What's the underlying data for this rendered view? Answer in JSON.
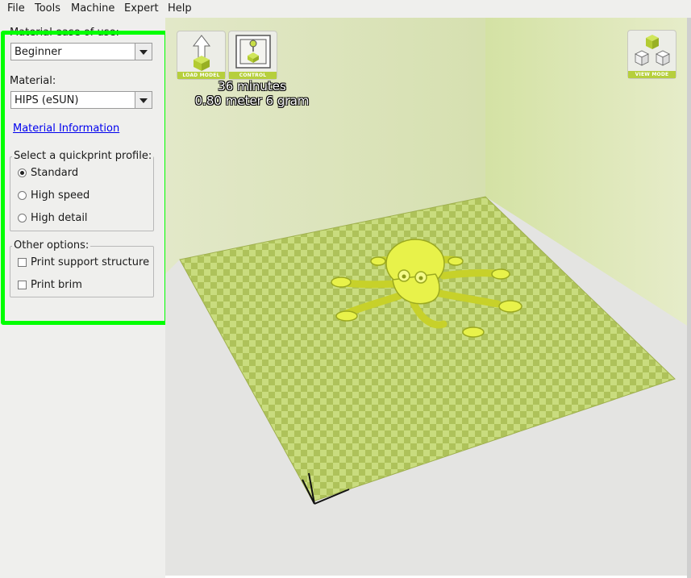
{
  "menu": [
    "File",
    "Tools",
    "Machine",
    "Expert",
    "Help"
  ],
  "left_panel": {
    "ease_label": "Material ease of use:",
    "ease_value": "Beginner",
    "material_label": "Material:",
    "material_value": "HIPS (eSUN)",
    "material_link": "Material Information",
    "quickprint_title": "Select a quickprint profile:",
    "profiles": [
      {
        "label": "Standard",
        "selected": true
      },
      {
        "label": "High speed",
        "selected": false
      },
      {
        "label": "High detail",
        "selected": false
      }
    ],
    "other_title": "Other options:",
    "options": [
      {
        "label": "Print support structure",
        "checked": false
      },
      {
        "label": "Print brim",
        "checked": false
      }
    ],
    "highlight_color": "#00ff00"
  },
  "viewport": {
    "buttons": {
      "load_model": "LOAD MODEL",
      "control": "CONTROL",
      "view_mode": "VIEW MODE"
    },
    "print_time": "36 minutes",
    "print_material": "0.80 meter 6 gram",
    "model_color": "#e8f24a",
    "bed_color_light": "#c9dc7e",
    "bed_color_dark": "#aec25a"
  }
}
